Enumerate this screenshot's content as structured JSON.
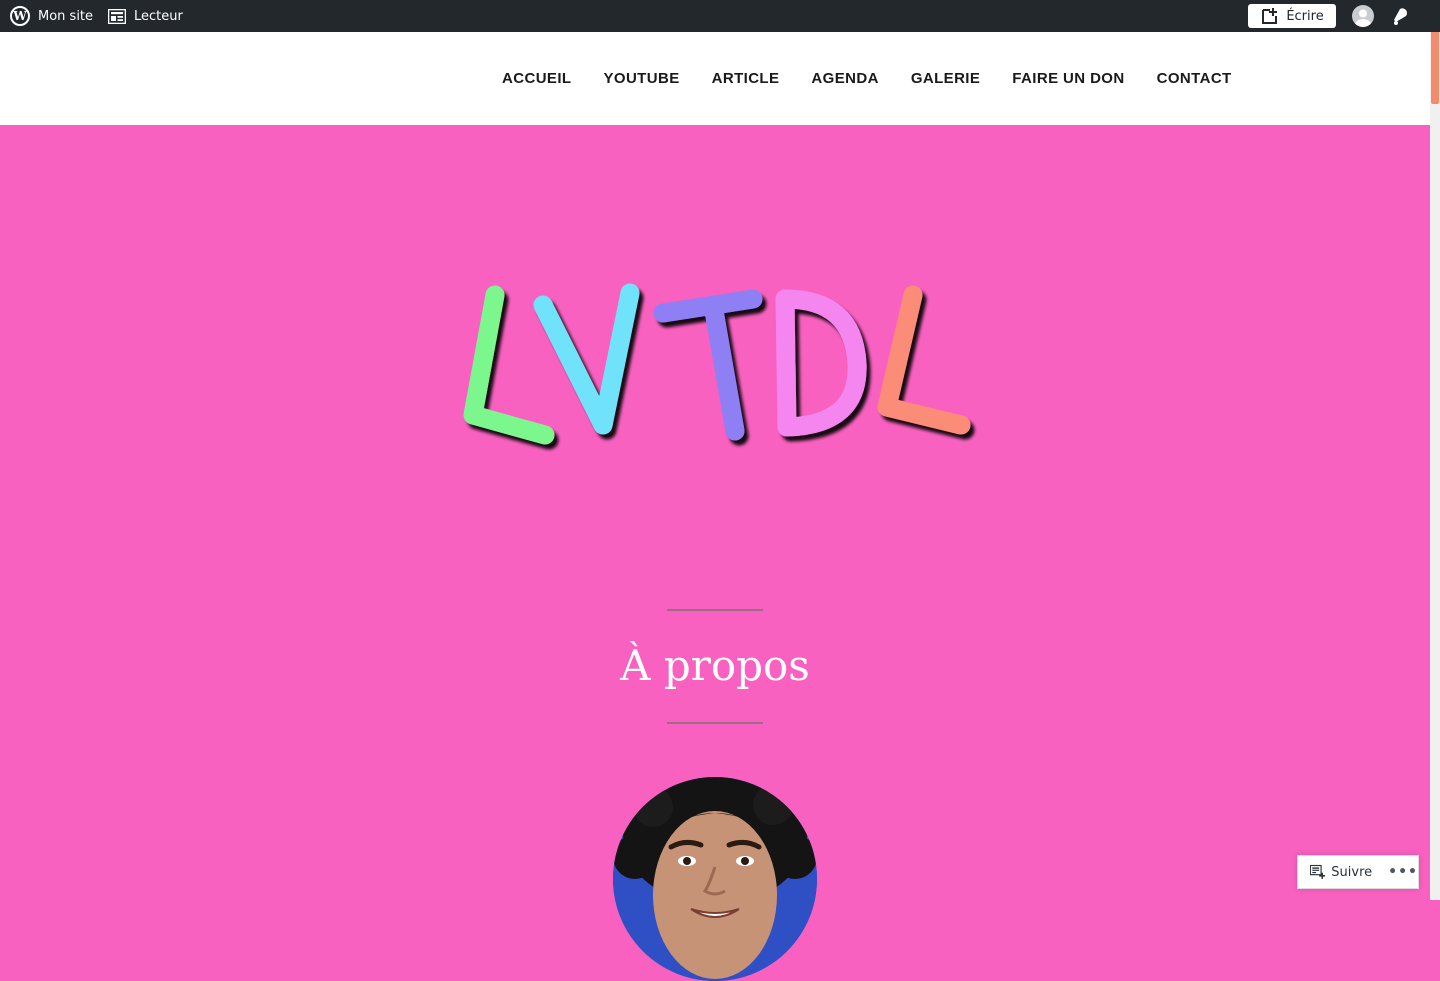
{
  "adminbar": {
    "my_site": "Mon site",
    "reader": "Lecteur",
    "write": "Écrire"
  },
  "nav": {
    "items": [
      "ACCUEIL",
      "YOUTUBE",
      "ARTICLE",
      "AGENDA",
      "GALERIE",
      "FAIRE UN DON",
      "CONTACT"
    ]
  },
  "hero": {
    "logo_text": "LVTDL",
    "logo_colors": [
      "#7cf78e",
      "#6fe2fa",
      "#8f7ff5",
      "#f586ef",
      "#fa8c78"
    ],
    "page_title": "À propos"
  },
  "follow": {
    "label": "Suivre",
    "more": "•••"
  },
  "colors": {
    "background": "#f961c0",
    "adminbar": "#23282d",
    "scroll_thumb": "#f38b6c"
  }
}
